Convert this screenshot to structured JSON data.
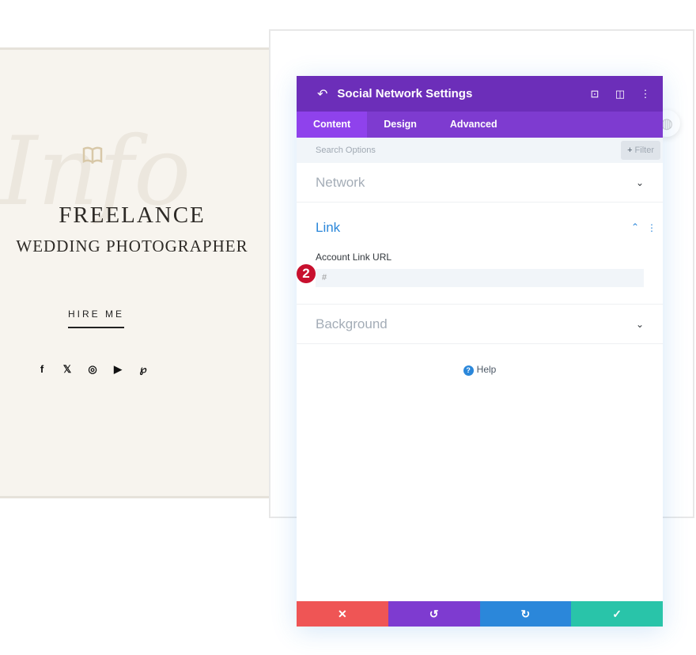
{
  "hero": {
    "script_text": "Info",
    "line1": "FREELANCE",
    "line2": "WEDDING PHOTOGRAPHER",
    "button": "HIRE ME",
    "social": [
      "f",
      "𝕏",
      "◎",
      "▶",
      "℘"
    ]
  },
  "modal": {
    "title": "Social Network Settings",
    "tabs": [
      "Content",
      "Design",
      "Advanced"
    ],
    "search_placeholder": "Search Options",
    "filter": "Filter",
    "sections": {
      "network": "Network",
      "link": "Link",
      "background": "Background"
    },
    "field_label": "Account Link URL",
    "field_value": "#",
    "badge": "2",
    "help": "Help"
  },
  "colors": {
    "header": "#6c2eb9",
    "tabs": "#7e3bd0",
    "cancel": "#ef5555",
    "undo": "#7e3bd0",
    "redo": "#2b87da",
    "save": "#29c4a9"
  }
}
